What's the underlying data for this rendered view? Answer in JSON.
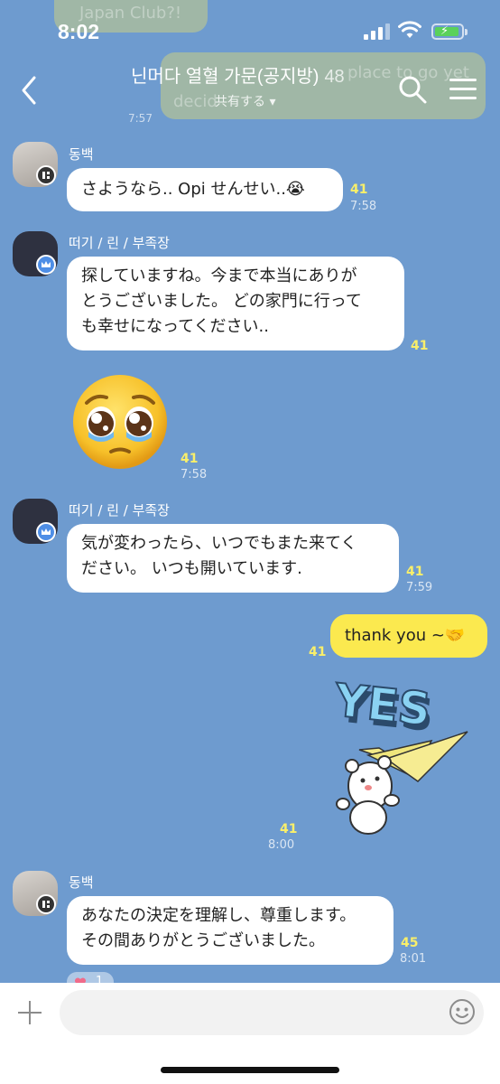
{
  "status_bar": {
    "time": "8:02"
  },
  "background_remnants": {
    "top_bubble_text": "Japan Club?!",
    "top_right_text": "place to go yet",
    "mid_text": "decid"
  },
  "header": {
    "title": "닌머다 열혈 가문(공지방)",
    "member_count": "48",
    "share_label": "共有する ▾",
    "previous_time": "7:57"
  },
  "messages": [
    {
      "sender": "동백",
      "text": "さようなら.. Opi せんせい..😭",
      "read": "41",
      "time": "7:58"
    },
    {
      "sender": "떠기 / 린 / 부족장",
      "lines": [
        "探していますね。今まで本当にありが",
        "とうございました。 どの家門に行って",
        "も幸せになってください.."
      ],
      "read": "41"
    },
    {
      "type": "emoji",
      "read": "41",
      "time": "7:58"
    },
    {
      "sender": "떠기 / 린 / 부족장",
      "lines": [
        "気が変わったら、いつでもまた来てく",
        "ださい。 いつも開いています."
      ],
      "read": "41",
      "time": "7:59"
    },
    {
      "mine": true,
      "text": "thank you ~🤝",
      "read": "41"
    },
    {
      "type": "sticker",
      "sticker_text": "YES",
      "read": "41",
      "time": "8:00"
    },
    {
      "sender": "동백",
      "lines": [
        "あなたの決定を理解し、尊重します。",
        "その間ありがとうございました。"
      ],
      "read": "45",
      "time": "8:01"
    }
  ],
  "reaction": {
    "count": "1"
  },
  "input": {
    "placeholder": ""
  },
  "colors": {
    "chat_background": "#6e9bcf",
    "my_bubble": "#fbe94f",
    "read_count": "#f9ef6a"
  },
  "icons": [
    "back-arrow-icon",
    "search-icon",
    "menu-icon",
    "plus-icon",
    "emoji-icon",
    "cellular-signal-icon",
    "wifi-icon",
    "battery-icon"
  ]
}
